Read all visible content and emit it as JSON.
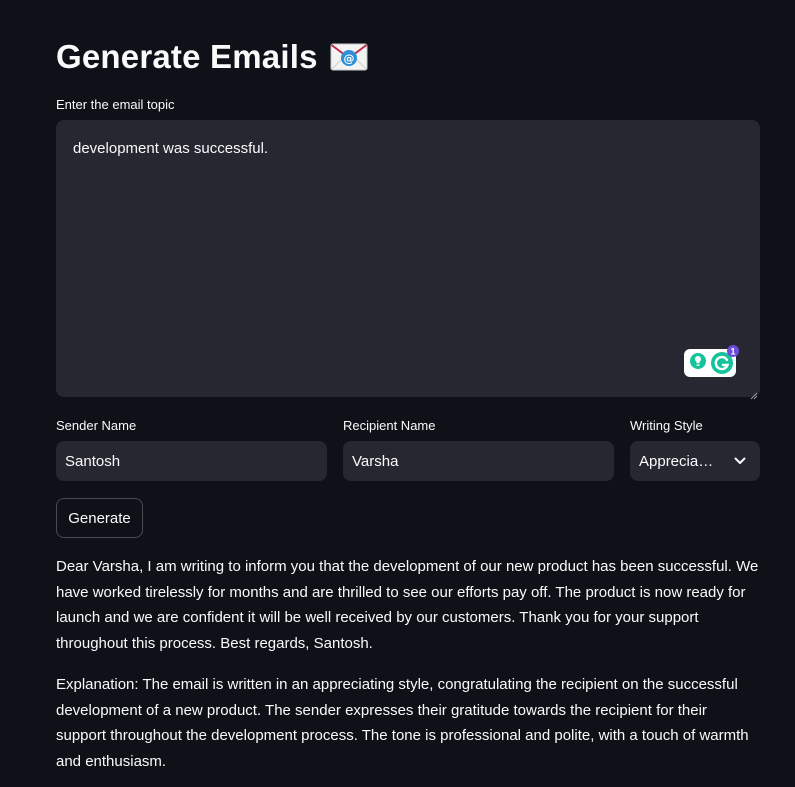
{
  "header": {
    "title": "Generate Emails",
    "title_icon": "envelope-with-at-icon"
  },
  "topic": {
    "label": "Enter the email topic",
    "value": "development was successful."
  },
  "sender": {
    "label": "Sender Name",
    "value": "Santosh"
  },
  "recipient": {
    "label": "Recipient Name",
    "value": "Varsha"
  },
  "style": {
    "label": "Writing Style",
    "value": "Apprecia…"
  },
  "generate_button": {
    "label": "Generate"
  },
  "grammarly": {
    "badge_count": "1"
  },
  "output": {
    "email": "Dear Varsha, I am writing to inform you that the development of our new product has been successful. We have worked tirelessly for months and are thrilled to see our efforts pay off. The product is now ready for launch and we are confident it will be well received by our customers. Thank you for your support throughout this process. Best regards, Santosh.",
    "explanation": "Explanation: The email is written in an appreciating style, congratulating the recipient on the successful development of a new product. The sender expresses their gratitude towards the recipient for their support throughout the development process. The tone is professional and polite, with a touch of warmth and enthusiasm."
  },
  "colors": {
    "background": "#0e1117",
    "input_background": "#262730",
    "text": "#fafafa",
    "grammarly_green": "#15c39a"
  }
}
